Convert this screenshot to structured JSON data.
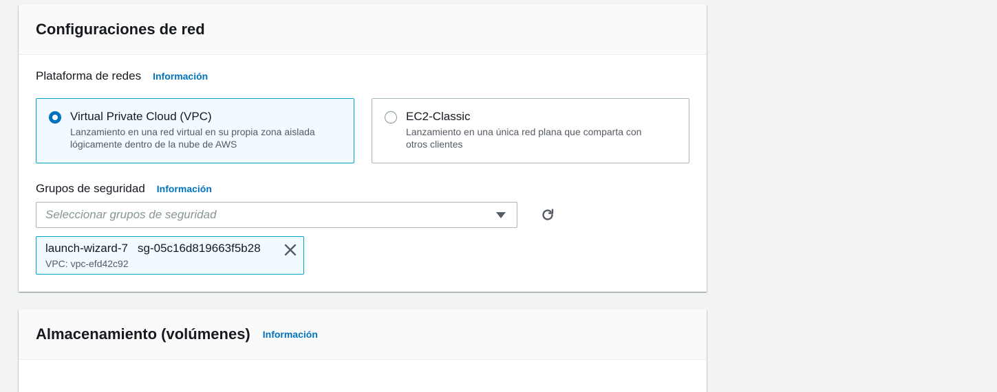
{
  "network": {
    "title": "Configuraciones de red",
    "platform": {
      "label": "Plataforma de redes",
      "info": "Información",
      "options": [
        {
          "title": "Virtual Private Cloud (VPC)",
          "desc_line1": "Lanzamiento en una red virtual en su propia zona aislada",
          "desc_line2": "lógicamente dentro de la nube de AWS",
          "selected": true
        },
        {
          "title": "EC2-Classic",
          "desc_line1": "Lanzamiento en una única red plana que comparta con",
          "desc_line2": "otros clientes",
          "selected": false
        }
      ]
    },
    "security_groups": {
      "label": "Grupos de seguridad",
      "info": "Información",
      "placeholder": "Seleccionar grupos de seguridad",
      "selected": [
        {
          "name": "launch-wizard-7",
          "id": "sg-05c16d819663f5b28",
          "vpc": "VPC: vpc-efd42c92"
        }
      ]
    }
  },
  "storage": {
    "title": "Almacenamiento (volúmenes)",
    "info": "Información"
  },
  "colors": {
    "accent": "#0073bb",
    "selected_border": "#00a1c9",
    "selected_bg": "#f1faff",
    "page_bg": "#f2f3f3"
  },
  "icons": {
    "caret": "caret-down-icon",
    "refresh": "refresh-icon",
    "close": "close-icon"
  }
}
